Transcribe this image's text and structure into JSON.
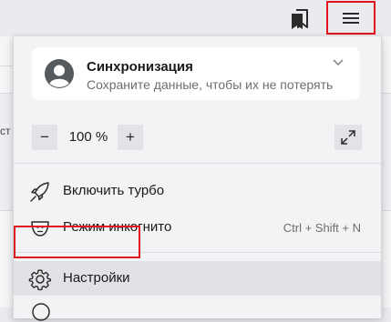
{
  "toolbar": {
    "bookmarks_icon": "bookmarks-icon",
    "menu_icon": "hamburger-menu-icon",
    "highlight_color": "#e0161c"
  },
  "background": {
    "cut_text": "ст"
  },
  "sync": {
    "title": "Синхронизация",
    "subtitle": "Сохраните данные, чтобы их не потерять",
    "avatar_icon": "user-avatar-icon",
    "chevron_icon": "chevron-down-icon"
  },
  "zoom": {
    "minus_label": "−",
    "value": "100 %",
    "plus_label": "+",
    "fullscreen_icon": "fullscreen-icon"
  },
  "menu": {
    "turbo_label": "Включить турбо",
    "turbo_icon": "rocket-icon",
    "incognito_label": "Режим инкогнито",
    "incognito_icon": "incognito-mask-icon",
    "incognito_shortcut": "Ctrl + Shift + N",
    "settings_label": "Настройки",
    "settings_icon": "gear-icon"
  }
}
